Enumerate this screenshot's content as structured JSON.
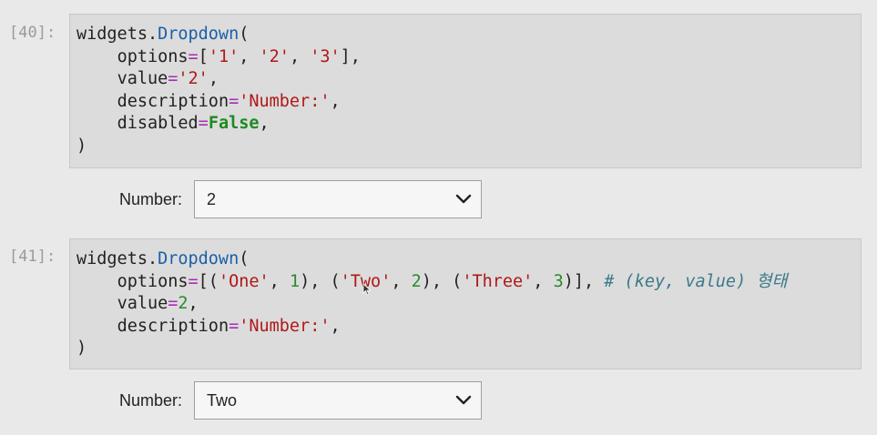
{
  "cells": [
    {
      "prompt": "[40]:",
      "code_lines": [
        [
          [
            "name",
            "widgets"
          ],
          [
            "punc",
            "."
          ],
          [
            "attr",
            "Dropdown"
          ],
          [
            "punc",
            "("
          ]
        ],
        [
          [
            "punc",
            "    "
          ],
          [
            "name",
            "options"
          ],
          [
            "op",
            "="
          ],
          [
            "punc",
            "["
          ],
          [
            "str",
            "'1'"
          ],
          [
            "punc",
            ", "
          ],
          [
            "str",
            "'2'"
          ],
          [
            "punc",
            ", "
          ],
          [
            "str",
            "'3'"
          ],
          [
            "punc",
            "],"
          ]
        ],
        [
          [
            "punc",
            "    "
          ],
          [
            "name",
            "value"
          ],
          [
            "op",
            "="
          ],
          [
            "str",
            "'2'"
          ],
          [
            "punc",
            ","
          ]
        ],
        [
          [
            "punc",
            "    "
          ],
          [
            "name",
            "description"
          ],
          [
            "op",
            "="
          ],
          [
            "str",
            "'Number:'"
          ],
          [
            "punc",
            ","
          ]
        ],
        [
          [
            "punc",
            "    "
          ],
          [
            "name",
            "disabled"
          ],
          [
            "op",
            "="
          ],
          [
            "kw",
            "False"
          ],
          [
            "punc",
            ","
          ]
        ],
        [
          [
            "punc",
            ")"
          ]
        ]
      ],
      "widget": {
        "label": "Number:",
        "selected": "2",
        "chevron_icon": "chevron-down-icon"
      }
    },
    {
      "prompt": "[41]:",
      "code_lines": [
        [
          [
            "name",
            "widgets"
          ],
          [
            "punc",
            "."
          ],
          [
            "attr",
            "Dropdown"
          ],
          [
            "punc",
            "("
          ]
        ],
        [
          [
            "punc",
            "    "
          ],
          [
            "name",
            "options"
          ],
          [
            "op",
            "="
          ],
          [
            "punc",
            "[("
          ],
          [
            "str",
            "'One'"
          ],
          [
            "punc",
            ", "
          ],
          [
            "num",
            "1"
          ],
          [
            "punc",
            "), ("
          ],
          [
            "str",
            "'Two'"
          ],
          [
            "punc",
            ", "
          ],
          [
            "num",
            "2"
          ],
          [
            "punc",
            "), ("
          ],
          [
            "str",
            "'Three'"
          ],
          [
            "punc",
            ", "
          ],
          [
            "num",
            "3"
          ],
          [
            "punc",
            ")], "
          ],
          [
            "cmt",
            "# (key, value) 형태"
          ]
        ],
        [
          [
            "punc",
            "    "
          ],
          [
            "name",
            "value"
          ],
          [
            "op",
            "="
          ],
          [
            "num",
            "2"
          ],
          [
            "punc",
            ","
          ]
        ],
        [
          [
            "punc",
            "    "
          ],
          [
            "name",
            "description"
          ],
          [
            "op",
            "="
          ],
          [
            "str",
            "'Number:'"
          ],
          [
            "punc",
            ","
          ]
        ],
        [
          [
            "punc",
            ")"
          ]
        ]
      ],
      "widget": {
        "label": "Number:",
        "selected": "Two",
        "chevron_icon": "chevron-down-icon"
      }
    }
  ],
  "colors": {
    "background": "#e9e9e9",
    "cell_bg": "#dcdcdc",
    "string": "#b01818",
    "number": "#2b8a2b",
    "keyword": "#1f8a1f",
    "operator": "#a72eb0",
    "attribute": "#1b5fa8",
    "comment": "#3a7a8a",
    "prompt": "#9a9a9a"
  }
}
